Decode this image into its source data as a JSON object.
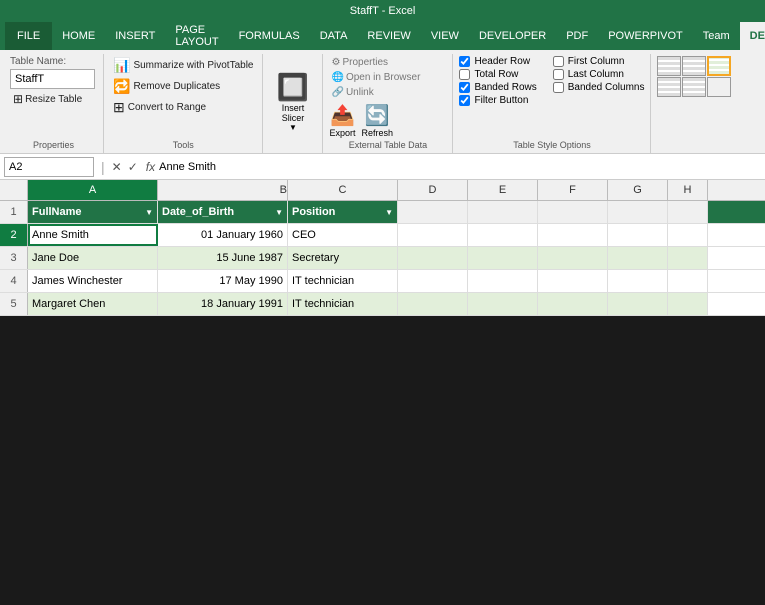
{
  "titleBar": {
    "text": "StaffT - Excel"
  },
  "ribbonTabs": [
    {
      "id": "file",
      "label": "FILE",
      "active": false,
      "isFile": true
    },
    {
      "id": "home",
      "label": "HOME",
      "active": false
    },
    {
      "id": "insert",
      "label": "INSERT",
      "active": false
    },
    {
      "id": "pageLayout",
      "label": "PAGE LAYOUT",
      "active": false
    },
    {
      "id": "formulas",
      "label": "FORMULAS",
      "active": false
    },
    {
      "id": "data",
      "label": "DATA",
      "active": false
    },
    {
      "id": "review",
      "label": "REVIEW",
      "active": false
    },
    {
      "id": "view",
      "label": "VIEW",
      "active": false
    },
    {
      "id": "developer",
      "label": "DEVELOPER",
      "active": false
    },
    {
      "id": "pdf",
      "label": "PDF",
      "active": false
    },
    {
      "id": "powerpivot",
      "label": "POWERPIVOT",
      "active": false
    },
    {
      "id": "team",
      "label": "Team",
      "active": false
    },
    {
      "id": "design",
      "label": "DESIGN",
      "active": true
    }
  ],
  "properties": {
    "groupLabel": "Properties",
    "tableNameLabel": "Table Name:",
    "tableName": "StaffT",
    "resizeBtn": "Resize Table"
  },
  "tools": {
    "groupLabel": "Tools",
    "summarizeBtn": "Summarize with PivotTable",
    "removeDuplicatesBtn": "Remove Duplicates",
    "convertBtn": "Convert to Range"
  },
  "insertSlicer": {
    "label": "Insert\nSlicer"
  },
  "exportGroup": {
    "groupLabel": "External Table Data",
    "exportLabel": "Export",
    "refreshLabel": "Refresh",
    "propertiesLabel": "Properties",
    "openBrowserLabel": "Open in Browser",
    "unlinkLabel": "Unlink"
  },
  "styleOptions": {
    "groupLabel": "Table Style Options",
    "headerRow": {
      "label": "Header Row",
      "checked": true
    },
    "totalRow": {
      "label": "Total Row",
      "checked": false
    },
    "bandedRows": {
      "label": "Banded Rows",
      "checked": true
    },
    "firstColumn": {
      "label": "First Column",
      "checked": false
    },
    "lastColumn": {
      "label": "Last Column",
      "checked": false
    },
    "bandedColumns": {
      "label": "Banded Columns",
      "checked": false
    },
    "filterButton": {
      "label": "Filter Button",
      "checked": true
    }
  },
  "formulaBar": {
    "nameBox": "A2",
    "formulaContent": "Anne Smith"
  },
  "columns": [
    {
      "id": "A",
      "label": "A",
      "selected": true
    },
    {
      "id": "B",
      "label": "B",
      "selected": false
    },
    {
      "id": "C",
      "label": "C",
      "selected": false
    },
    {
      "id": "D",
      "label": "D",
      "selected": false
    },
    {
      "id": "E",
      "label": "E",
      "selected": false
    },
    {
      "id": "F",
      "label": "F",
      "selected": false
    },
    {
      "id": "G",
      "label": "G",
      "selected": false
    },
    {
      "id": "H",
      "label": "H",
      "selected": false
    }
  ],
  "rows": [
    {
      "rowNum": "1",
      "isHeader": true,
      "cells": [
        {
          "col": "A",
          "value": "FullName",
          "hasDropdown": true
        },
        {
          "col": "B",
          "value": "Date_of_Birth",
          "hasDropdown": true
        },
        {
          "col": "C",
          "value": "Position",
          "hasDropdown": true
        },
        {
          "col": "D",
          "value": ""
        },
        {
          "col": "E",
          "value": ""
        },
        {
          "col": "F",
          "value": ""
        },
        {
          "col": "G",
          "value": ""
        },
        {
          "col": "H",
          "value": ""
        }
      ]
    },
    {
      "rowNum": "2",
      "isActive": true,
      "isBanded": false,
      "cells": [
        {
          "col": "A",
          "value": "Anne Smith",
          "isActive": true
        },
        {
          "col": "B",
          "value": "01 January 1960",
          "align": "right"
        },
        {
          "col": "C",
          "value": "CEO"
        },
        {
          "col": "D",
          "value": ""
        },
        {
          "col": "E",
          "value": ""
        },
        {
          "col": "F",
          "value": ""
        },
        {
          "col": "G",
          "value": ""
        },
        {
          "col": "H",
          "value": ""
        }
      ]
    },
    {
      "rowNum": "3",
      "isBanded": true,
      "cells": [
        {
          "col": "A",
          "value": "Jane Doe"
        },
        {
          "col": "B",
          "value": "15 June 1987",
          "align": "right"
        },
        {
          "col": "C",
          "value": "Secretary"
        },
        {
          "col": "D",
          "value": ""
        },
        {
          "col": "E",
          "value": ""
        },
        {
          "col": "F",
          "value": ""
        },
        {
          "col": "G",
          "value": ""
        },
        {
          "col": "H",
          "value": ""
        }
      ]
    },
    {
      "rowNum": "4",
      "isBanded": false,
      "cells": [
        {
          "col": "A",
          "value": "James Winchester"
        },
        {
          "col": "B",
          "value": "17 May 1990",
          "align": "right"
        },
        {
          "col": "C",
          "value": "IT technician"
        },
        {
          "col": "D",
          "value": ""
        },
        {
          "col": "E",
          "value": ""
        },
        {
          "col": "F",
          "value": ""
        },
        {
          "col": "G",
          "value": ""
        },
        {
          "col": "H",
          "value": ""
        }
      ]
    },
    {
      "rowNum": "5",
      "isBanded": true,
      "cells": [
        {
          "col": "A",
          "value": "Margaret Chen"
        },
        {
          "col": "B",
          "value": "18 January 1991",
          "align": "right"
        },
        {
          "col": "C",
          "value": "IT technician"
        },
        {
          "col": "D",
          "value": ""
        },
        {
          "col": "E",
          "value": ""
        },
        {
          "col": "F",
          "value": ""
        },
        {
          "col": "G",
          "value": ""
        },
        {
          "col": "H",
          "value": ""
        }
      ]
    }
  ],
  "colors": {
    "accent": "#217346",
    "tableGreen": "#107c41",
    "bandedBg": "#e2efda",
    "activeBg": "#ffffff",
    "headerBg": "#f0f0f0",
    "selectedBg": "#fff2cc"
  }
}
